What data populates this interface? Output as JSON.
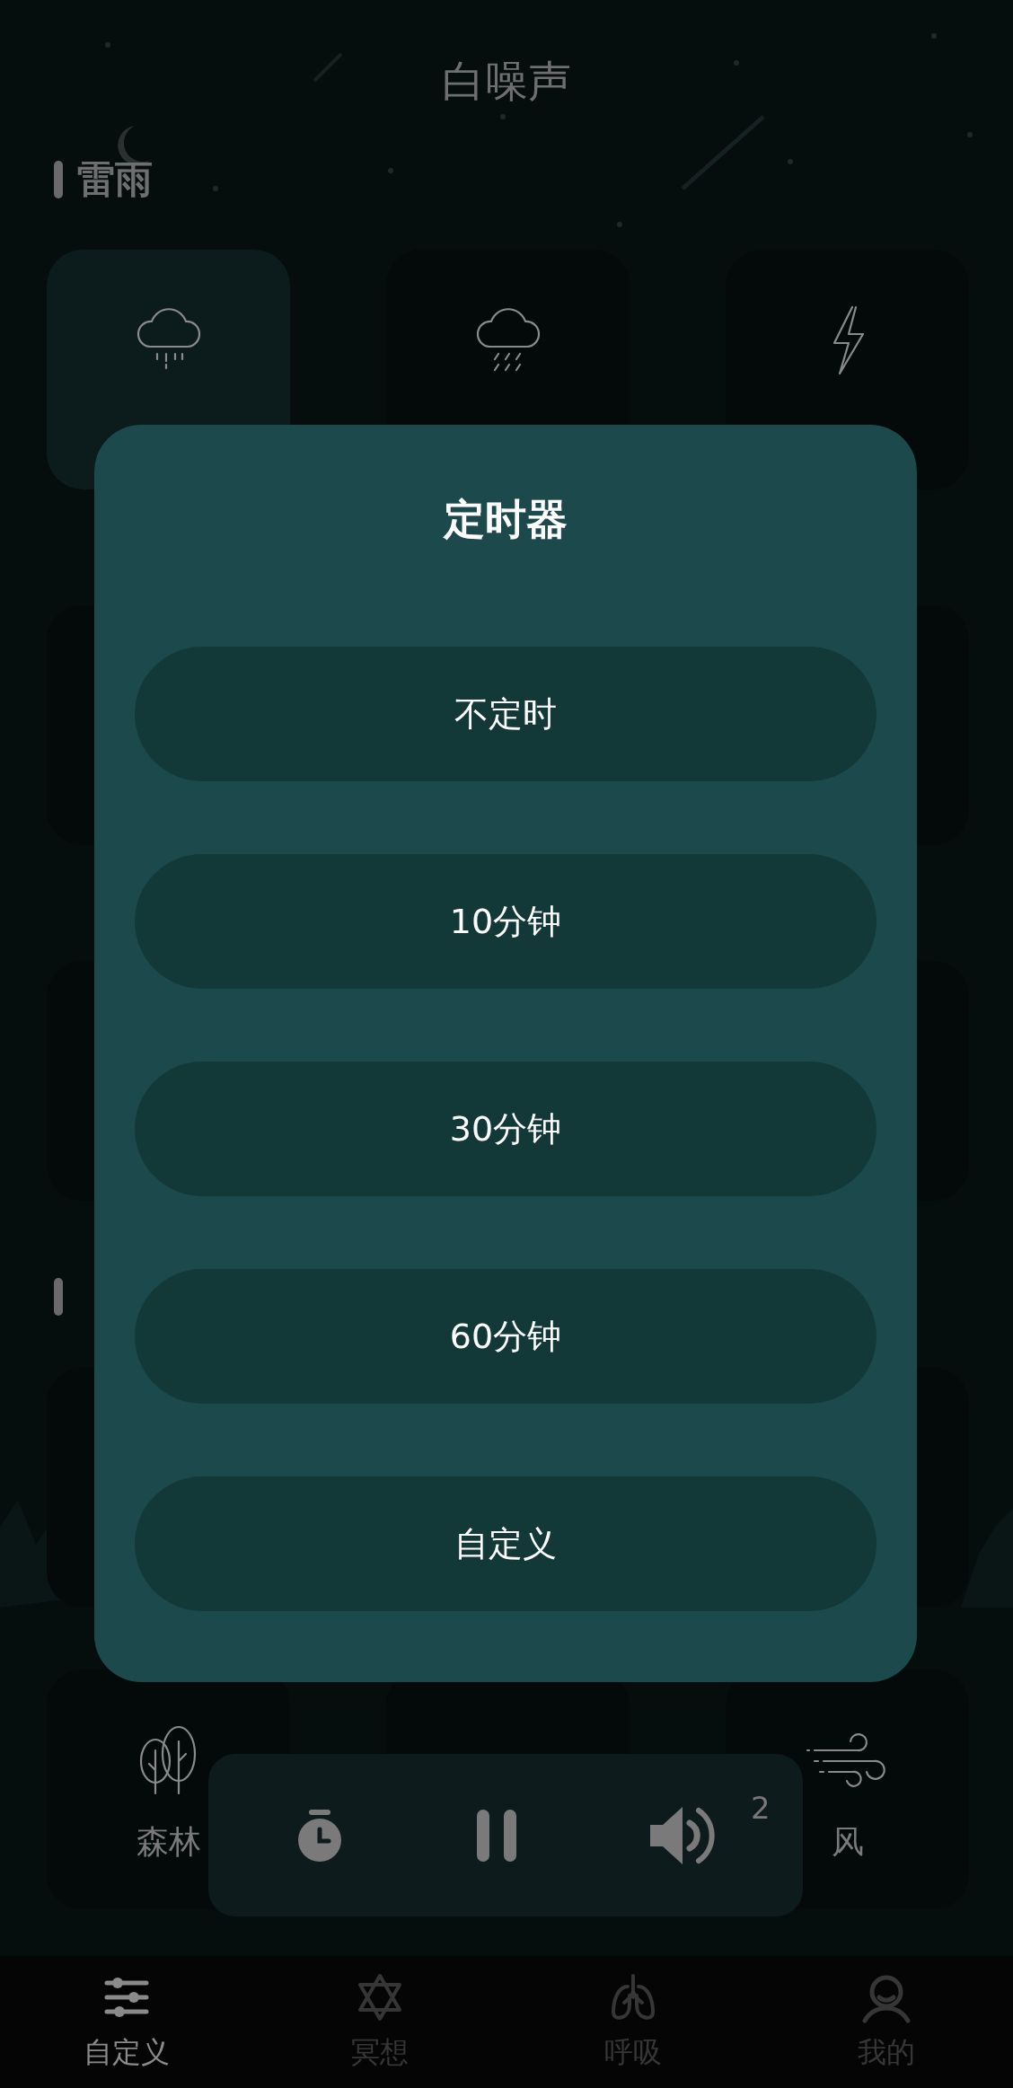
{
  "header": {
    "title": "白噪声"
  },
  "sections": [
    {
      "title": "雷雨",
      "rows": [
        [
          {
            "selected": true
          },
          {
            "selected": false
          },
          {
            "selected": false
          }
        ],
        [
          {
            "selected": false
          },
          null,
          {
            "selected": false
          }
        ],
        [
          {
            "selected": false
          },
          null,
          {
            "selected": false
          }
        ]
      ]
    },
    {
      "rows": [
        [
          {
            "selected": false
          },
          null,
          {
            "selected": false
          }
        ],
        [
          {
            "selected": false,
            "label": "森林"
          },
          {
            "selected": false
          },
          {
            "selected": false,
            "label": "风"
          }
        ]
      ]
    }
  ],
  "timer_dialog": {
    "title": "定时器",
    "options": [
      {
        "label": "不定时",
        "selected": false
      },
      {
        "label": "10分钟",
        "selected": false
      },
      {
        "label": "30分钟",
        "selected": false
      },
      {
        "label": "60分钟",
        "selected": false
      },
      {
        "label": "自定义",
        "selected": false
      }
    ]
  },
  "player": {
    "volume_badge": "2"
  },
  "tabs": [
    {
      "label": "自定义",
      "selected": true
    },
    {
      "label": "冥想",
      "selected": false
    },
    {
      "label": "呼吸",
      "selected": false
    },
    {
      "label": "我的",
      "selected": false
    }
  ]
}
